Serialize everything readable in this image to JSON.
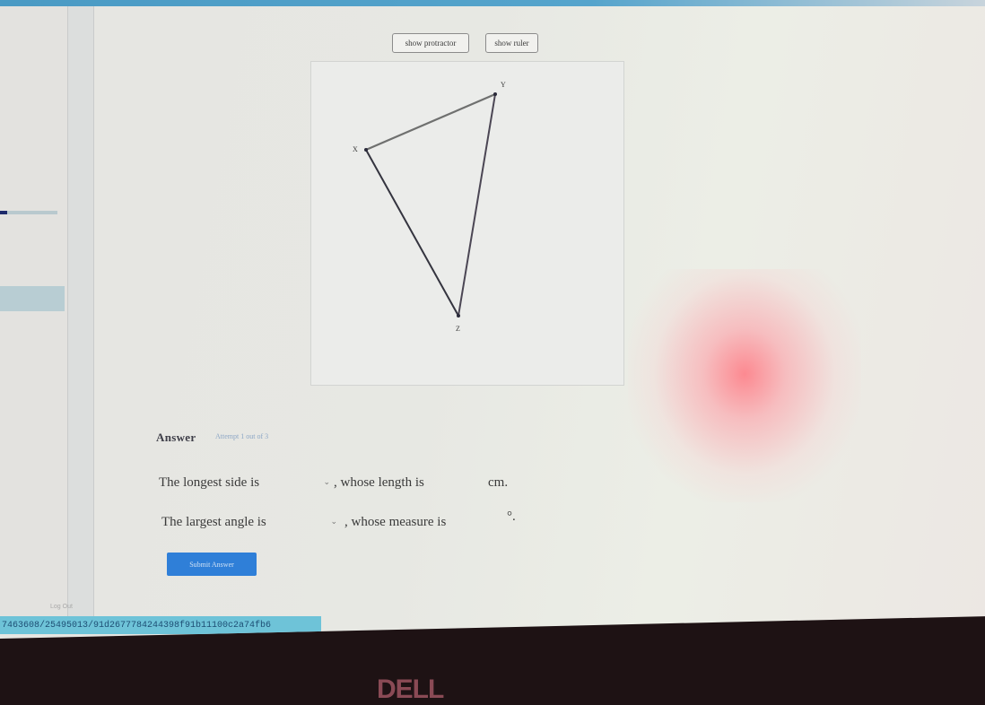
{
  "toolbar": {
    "protractor_label": "show protractor",
    "ruler_label": "show ruler"
  },
  "figure": {
    "vertices": [
      {
        "name": "X",
        "label": "X"
      },
      {
        "name": "Y",
        "label": "Y"
      },
      {
        "name": "Z",
        "label": "Z"
      }
    ],
    "sides": [
      "XY",
      "YZ",
      "XZ"
    ]
  },
  "answer": {
    "heading": "Answer",
    "attempt_text": "Attempt 1 out of 3",
    "row1": {
      "prefix": "The longest side is",
      "select_value": "",
      "middle": ", whose length is",
      "input_value": "",
      "suffix": "cm."
    },
    "row2": {
      "prefix": "The largest angle is",
      "select_value": "",
      "middle": ", whose measure is",
      "input_value": "",
      "suffix": "°."
    },
    "submit_label": "Submit Answer"
  },
  "footer": {
    "logout_label": "Log Out",
    "url_text": "7463608/25495013/91d2677784244398f91b11100c2a74fb6"
  },
  "bezel": {
    "brand": "DELL"
  },
  "colors": {
    "accent": "#2f7fd8",
    "topbar": "#4a9ac4",
    "urlbar": "#6ec3d8"
  }
}
